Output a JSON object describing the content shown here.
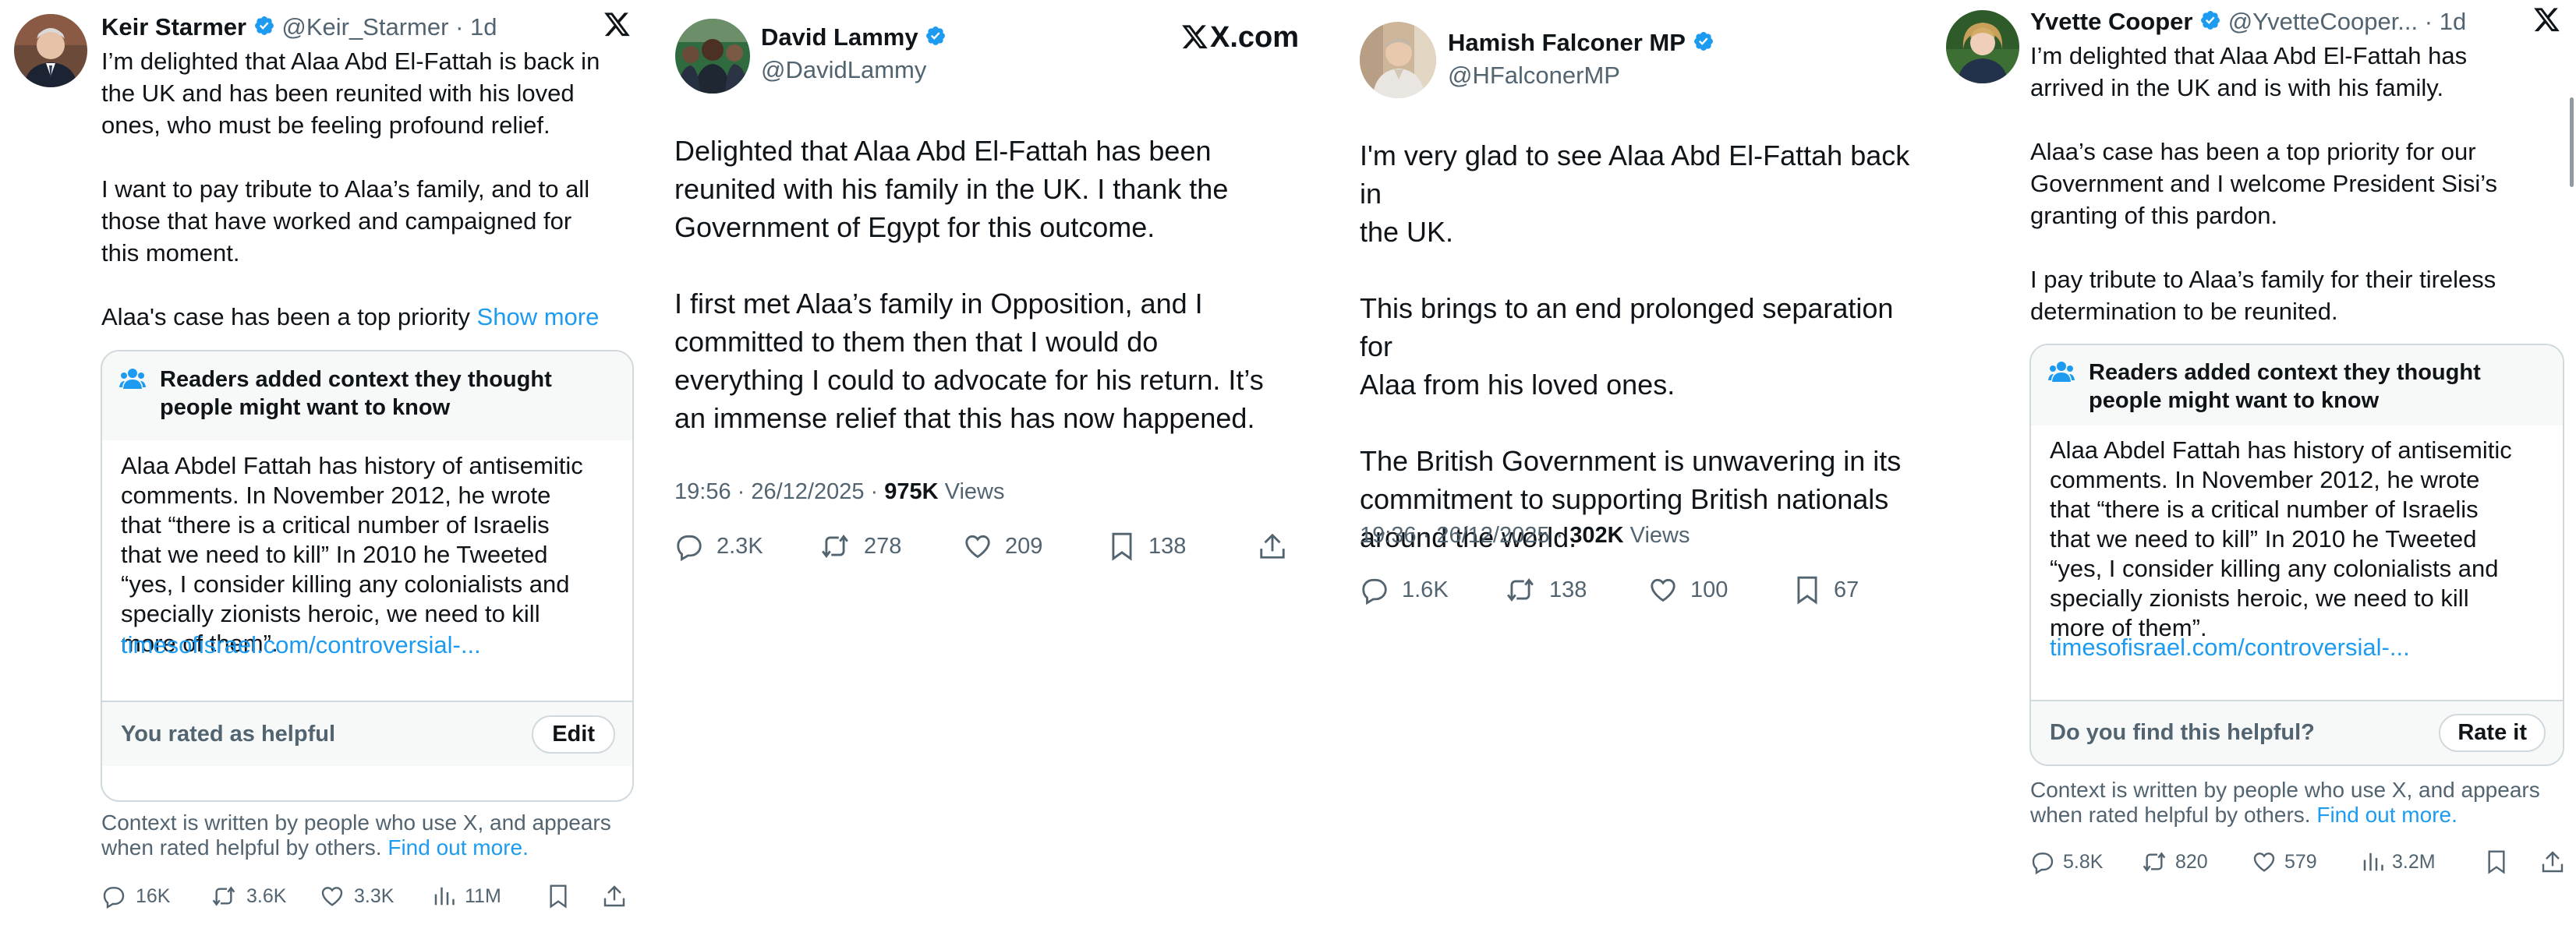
{
  "colors": {
    "link": "#1d9bf0",
    "text": "#0f1419",
    "secondary": "#536471",
    "border": "#cfd9de",
    "verified": "#1d9bf0"
  },
  "tweets": [
    {
      "name": "Keir Starmer",
      "handle": "@Keir_Starmer",
      "time": "· 1d",
      "text": "I’m delighted that Alaa Abd El-Fattah is back in\nthe UK and has been reunited with his loved\nones, who must be feeling profound relief.\n\nI want to pay tribute to Alaa’s family, and to all\nthose that have worked and campaigned for\nthis moment.\n\nAlaa's case has been a top priority ",
      "show_more": "Show more",
      "note": {
        "title": "Readers added context they thought\npeople might want to know",
        "body": "Alaa Abdel Fattah has history of antisemitic\ncomments. In November 2012, he wrote\nthat “there is a critical number of Israelis\nthat we need to kill” In 2010 he Tweeted\n“yes, I consider killing any colonialists and\nspecially zionists heroic, we need to kill\nmore of them”.",
        "link": "timesofisrael.com/controversial-...",
        "footer": "You rated as helpful",
        "button": "Edit"
      },
      "context": "Context is written by people who use X, and appears\nwhen rated helpful by others. ",
      "find_out": "Find out more.",
      "stats": {
        "replies": "16K",
        "reposts": "3.6K",
        "likes": "3.3K",
        "views": "11M"
      }
    },
    {
      "name": "David Lammy",
      "handle": "@DavidLammy",
      "brand": "X.com",
      "text": "Delighted that Alaa Abd El-Fattah has been\nreunited with his family in the UK. I thank the\nGovernment of Egypt for this outcome.\n\nI first met Alaa’s family in Opposition, and I\ncommitted to them then that I would do\neverything I could to advocate for his return. It’s\nan immense relief that this has now happened.",
      "meta_time": "19:56 · 26/12/2025 · ",
      "meta_views": "975K",
      "meta_views_label": " Views",
      "stats": {
        "replies": "2.3K",
        "reposts": "278",
        "likes": "209",
        "bookmarks": "138"
      }
    },
    {
      "name": "Hamish Falconer MP",
      "handle": "@HFalconerMP",
      "text": "I'm very glad to see Alaa Abd El-Fattah back in\nthe UK.\n\nThis brings to an end prolonged separation for\nAlaa from his loved ones.\n\nThe British Government is unwavering in its\ncommitment to supporting British nationals\naround the world.",
      "meta_time": "19:36 · 26/12/2025 · ",
      "meta_views": "302K",
      "meta_views_label": " Views",
      "stats": {
        "replies": "1.6K",
        "reposts": "138",
        "likes": "100",
        "bookmarks": "67"
      }
    },
    {
      "name": "Yvette Cooper",
      "handle": "@YvetteCooper...",
      "time": "· 1d",
      "text": "I’m delighted that Alaa Abd El-Fattah has\narrived in the UK and is with his family.\n\nAlaa’s case has been a top priority for our\nGovernment and I welcome President Sisi’s\ngranting of this pardon.\n\nI pay tribute to Alaa’s family for their tireless\ndetermination to be reunited.",
      "note": {
        "title": "Readers added context they thought\npeople might want to know",
        "body": "Alaa Abdel Fattah has history of antisemitic\ncomments. In November 2012, he wrote\nthat “there is a critical number of Israelis\nthat we need to kill” In 2010 he Tweeted\n“yes, I consider killing any colonialists and\nspecially zionists heroic, we need to kill\nmore of them”.",
        "link": "timesofisrael.com/controversial-...",
        "footer": "Do you find this helpful?",
        "button": "Rate it"
      },
      "context": "Context is written by people who use X, and appears\nwhen rated helpful by others. ",
      "find_out": "Find out more.",
      "stats": {
        "replies": "5.8K",
        "reposts": "820",
        "likes": "579",
        "views": "3.2M"
      }
    }
  ]
}
